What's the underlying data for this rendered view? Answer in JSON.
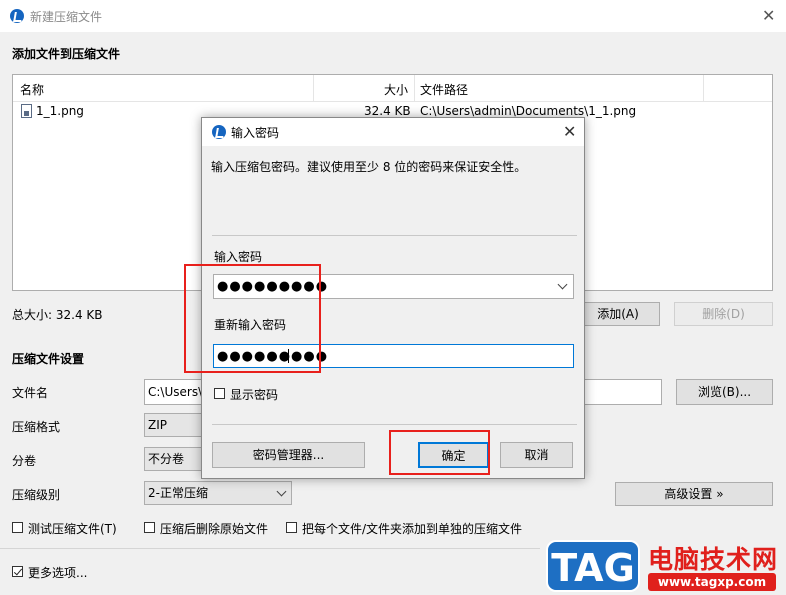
{
  "window": {
    "title": "新建压缩文件",
    "close_glyph": "✕"
  },
  "add_section": {
    "title": "添加文件到压缩文件",
    "columns": {
      "name": "名称",
      "size": "大小",
      "path": "文件路径"
    },
    "files": [
      {
        "name": "1_1.png",
        "size": "32.4 KB",
        "path": "C:\\Users\\admin\\Documents\\1_1.png",
        "icon": "image-file-icon"
      }
    ],
    "total_size": "总大小: 32.4 KB",
    "add_button": "添加(A)",
    "delete_button": "删除(D)"
  },
  "settings": {
    "title": "压缩文件设置",
    "filename_label": "文件名",
    "filename_value": "C:\\Users\\",
    "browse_button": "浏览(B)...",
    "format_label": "压缩格式",
    "format_value": "ZIP",
    "split_label": "分卷",
    "split_value": "不分卷",
    "level_label": "压缩级别",
    "level_value": "2-正常压缩",
    "advanced_button": "高级设置 »",
    "options": [
      {
        "label": "测试压缩文件(T)",
        "checked": false
      },
      {
        "label": "压缩后删除原始文件",
        "checked": false
      },
      {
        "label": "把每个文件/文件夹添加到单独的压缩文件",
        "checked": false
      }
    ],
    "more_options": {
      "label": "更多选项...",
      "checked": true
    }
  },
  "password_dialog": {
    "title": "输入密码",
    "close_glyph": "✕",
    "description": "输入压缩包密码。建议使用至少 8 位的密码来保证安全性。",
    "password_label": "输入密码",
    "password_value": "●●●●●●●●●",
    "confirm_label": "重新输入密码",
    "confirm_value": "●●●●●●●●●",
    "show_password": {
      "label": "显示密码",
      "checked": false
    },
    "manager_button": "密码管理器...",
    "ok_button": "确定",
    "cancel_button": "取消"
  },
  "watermark": {
    "logo": "TAG",
    "site_name": "电脑技术网",
    "url": "www.tagxp.com"
  },
  "colors": {
    "highlight_red": "#e8201c",
    "focus_blue": "#0078d7",
    "app_icon_blue": "#1565c0",
    "watermark_blue": "#1e6fc3"
  }
}
